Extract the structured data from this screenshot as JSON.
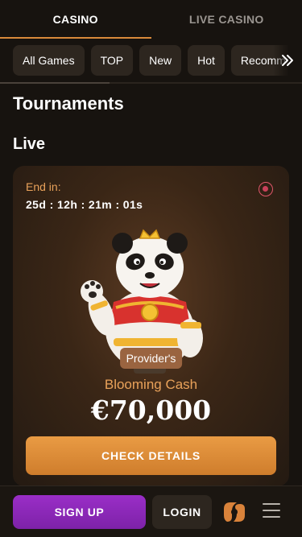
{
  "tabs": [
    {
      "label": "CASINO",
      "active": true
    },
    {
      "label": "LIVE CASINO",
      "active": false
    }
  ],
  "categories": [
    "All Games",
    "TOP",
    "New",
    "Hot",
    "Recommended"
  ],
  "page": {
    "title": "Tournaments",
    "section": "Live"
  },
  "card": {
    "end_label": "End in:",
    "countdown": "25d : 12h : 21m : 01s",
    "provider_badge": "Provider's",
    "name": "Blooming Cash",
    "prize": "€70,000",
    "button": "CHECK DETAILS"
  },
  "bottom": {
    "signup": "SIGN UP",
    "login": "LOGIN"
  },
  "colors": {
    "accent": "#d98a3a",
    "signup": "#8b28b8",
    "live_dot": "#e0566a"
  },
  "icons": [
    "chevrons-right-icon",
    "live-indicator-icon",
    "brand-logo-icon",
    "hamburger-menu-icon"
  ]
}
